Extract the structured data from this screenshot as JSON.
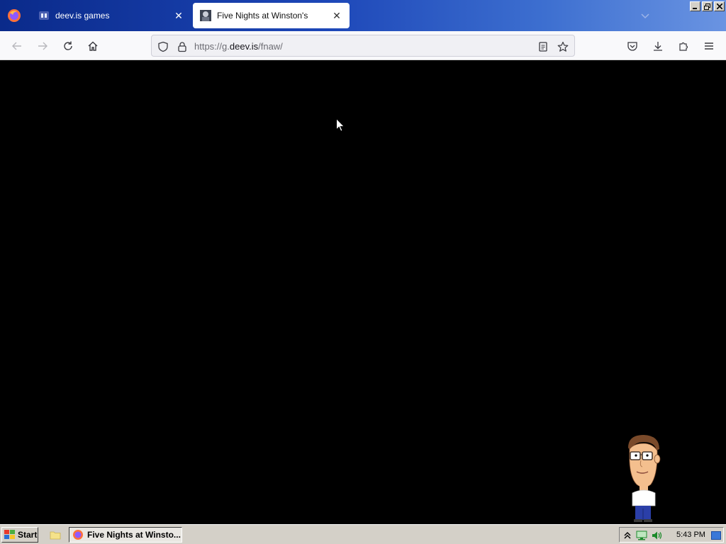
{
  "browser": {
    "tabs": [
      {
        "title": "deev.is games",
        "active": false,
        "icon": "deev-favicon"
      },
      {
        "title": "Five Nights at Winston's",
        "active": true,
        "icon": "fnaw-favicon"
      }
    ],
    "url": {
      "prefix": "https://g.",
      "host": "deev.is",
      "path": "/fnaw/"
    },
    "icons": {
      "back": "back-arrow-icon",
      "forward": "forward-arrow-icon",
      "reload": "reload-icon",
      "home": "home-icon",
      "shield": "tracking-protection-shield-icon",
      "lock": "lock-icon",
      "reader": "reader-view-icon",
      "bookmark": "bookmark-star-icon",
      "pocket": "pocket-icon",
      "downloads": "download-icon",
      "extensions": "extensions-puzzle-icon",
      "menu": "hamburger-menu-icon"
    }
  },
  "content": {
    "background": "#000000"
  },
  "taskbar": {
    "start_label": "Start",
    "task_label": "Five Nights at Winsto...",
    "clock": "5:43 PM"
  }
}
